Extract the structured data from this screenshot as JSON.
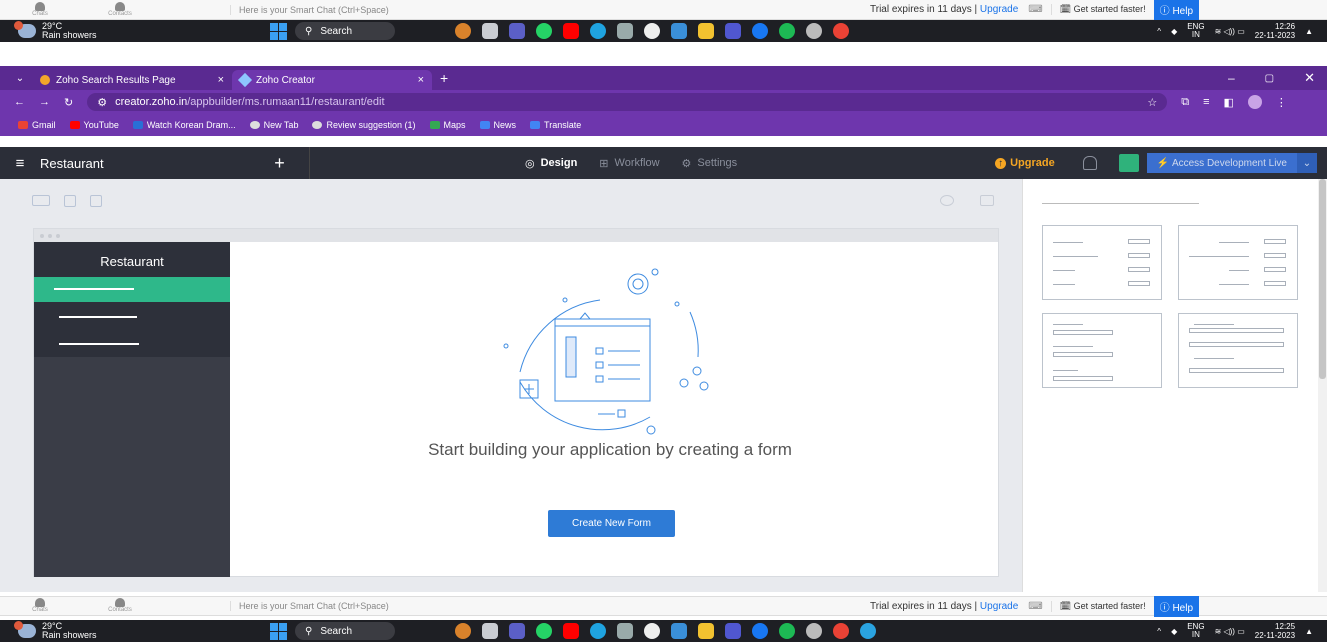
{
  "zoho_chat_bar": {
    "chats": "Chats",
    "contacts": "Contacts",
    "chat_placeholder": "Here is your Smart Chat (Ctrl+Space)",
    "trial_prefix": "Trial expires in",
    "trial_days": "11 days",
    "separator": "|",
    "upgrade": "Upgrade",
    "get_started": "Get started faster!",
    "help": "Help"
  },
  "taskbar_top": {
    "temp": "29°C",
    "weather": "Rain showers",
    "search": "Search",
    "lang1": "ENG",
    "lang2": "IN",
    "time": "12:26",
    "date": "22-11-2023"
  },
  "taskbar_bottom": {
    "temp": "29°C",
    "weather": "Rain showers",
    "search": "Search",
    "lang1": "ENG",
    "lang2": "IN",
    "time": "12:25",
    "date": "22-11-2023"
  },
  "browser": {
    "tabs": [
      {
        "label": "Zoho Search Results Page"
      },
      {
        "label": "Zoho Creator"
      }
    ],
    "url_domain": "creator.zoho.in",
    "url_path": "/appbuilder/ms.rumaan11/restaurant/edit",
    "bookmarks": [
      "Gmail",
      "YouTube",
      "Watch Korean Dram...",
      "New Tab",
      "Review suggestion (1)",
      "Maps",
      "News",
      "Translate"
    ]
  },
  "creator": {
    "app_name": "Restaurant",
    "tabs": [
      "Design",
      "Workflow",
      "Settings"
    ],
    "upgrade": "Upgrade",
    "access": "Access Development Live",
    "sidebar_title": "Restaurant",
    "empty_message": "Start building your application by creating a form",
    "create_button": "Create New Form"
  },
  "colors": {
    "browser_accent": "#6e36ad",
    "sidebar_selected": "#2eb88a",
    "primary_button": "#2e7bd6",
    "upgrade": "#f5a623"
  }
}
